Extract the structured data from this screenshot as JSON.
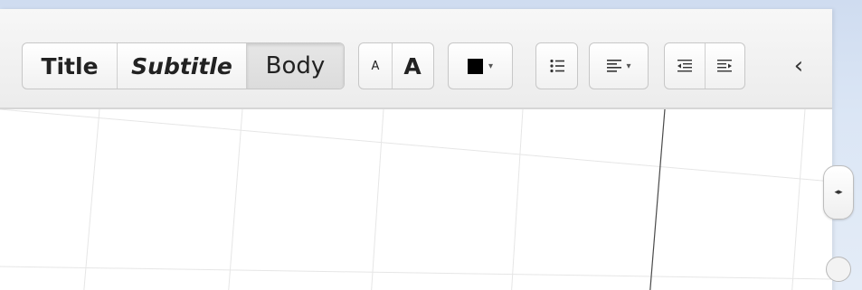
{
  "toolbar": {
    "styles": {
      "title": "Title",
      "subtitle": "Subtitle",
      "body": "Body",
      "selected": "Body"
    },
    "font_size": {
      "decrease_label": "A",
      "increase_label": "A"
    },
    "text_color": {
      "swatch_color": "#000000",
      "caret": "▾"
    },
    "list_icon": "bulleted-list-icon",
    "align": {
      "icon": "align-left-icon",
      "caret": "▾"
    },
    "indent": {
      "decrease_icon": "indent-decrease-icon",
      "increase_icon": "indent-increase-icon"
    },
    "collapse_glyph": "‹"
  },
  "splitter": {
    "glyph": "◂▸"
  },
  "colors": {
    "background": "#dbe6f5",
    "panel": "#ffffff",
    "toolbar_border": "#d6d6d6"
  }
}
